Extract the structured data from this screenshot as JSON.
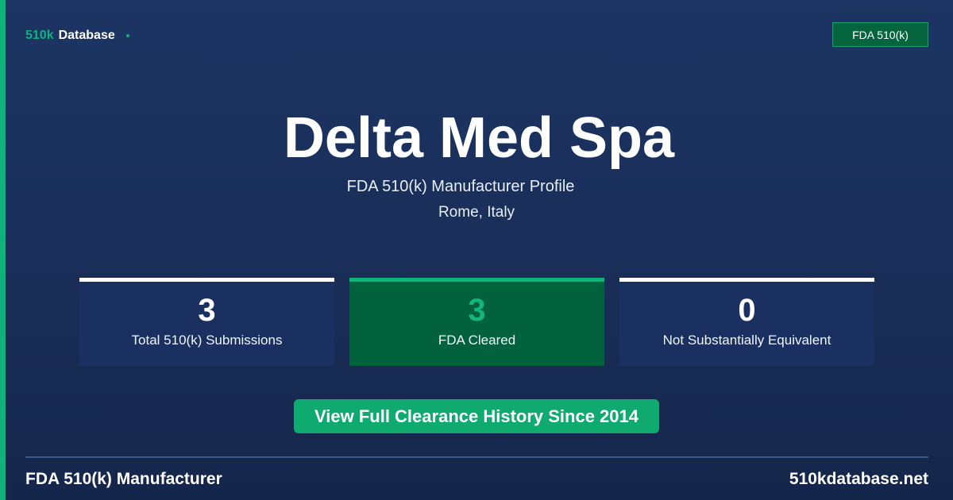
{
  "brand": {
    "accent": "510k",
    "name": "Database"
  },
  "badge": {
    "label": "FDA 510(k)"
  },
  "header": {
    "title": "Delta Med Spa",
    "subtitle": "FDA 510(k) Manufacturer Profile",
    "location": "Rome, Italy"
  },
  "stats": [
    {
      "value": "3",
      "label": "Total 510(k) Submissions"
    },
    {
      "value": "3",
      "label": "FDA Cleared"
    },
    {
      "value": "0",
      "label": "Not Substantially Equivalent"
    }
  ],
  "cta": {
    "label": "View Full Clearance History Since 2014"
  },
  "footer": {
    "left": "FDA 510(k) Manufacturer",
    "right": "510kdatabase.net"
  },
  "colors": {
    "accent": "#10b27c",
    "background": "#1a2f5a",
    "highlight_card": "#03623e",
    "card": "#193061"
  }
}
